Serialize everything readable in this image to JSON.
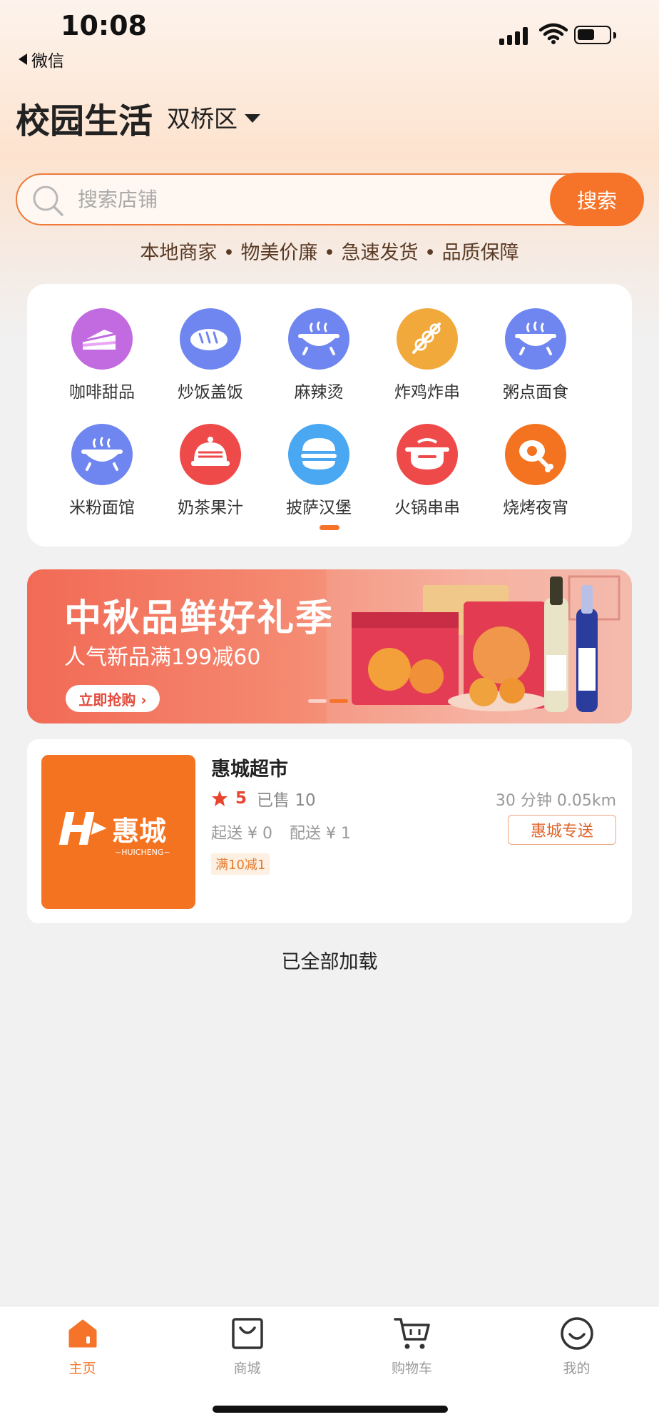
{
  "status_bar": {
    "time": "10:08",
    "back_app": "微信",
    "battery_level": 0.55
  },
  "header": {
    "title": "校园生活",
    "district": "双桥区"
  },
  "search": {
    "placeholder": "搜索店铺",
    "button_label": "搜索"
  },
  "slogan": "本地商家 • 物美价廉 • 急速发货 • 品质保障",
  "categories": [
    {
      "label": "咖啡甜品",
      "icon": "cake-icon",
      "color": "#c26ae0"
    },
    {
      "label": "炒饭盖饭",
      "icon": "bread-icon",
      "color": "#6f86f0"
    },
    {
      "label": "麻辣烫",
      "icon": "hotpot-bowl-icon",
      "color": "#6f86f0"
    },
    {
      "label": "炸鸡炸串",
      "icon": "skewer-icon",
      "color": "#f0a93a"
    },
    {
      "label": "粥点面食",
      "icon": "hotpot-bowl-icon",
      "color": "#6f86f0"
    },
    {
      "label": "米粉面馆",
      "icon": "hotpot-bowl-icon",
      "color": "#6f86f0"
    },
    {
      "label": "奶茶果汁",
      "icon": "cloche-icon",
      "color": "#ef4a4a"
    },
    {
      "label": "披萨汉堡",
      "icon": "burger-icon",
      "color": "#4aa7f2"
    },
    {
      "label": "火锅串串",
      "icon": "pot-icon",
      "color": "#ef4a4a"
    },
    {
      "label": "烧烤夜宵",
      "icon": "drumstick-icon",
      "color": "#f47321"
    }
  ],
  "banner": {
    "title": "中秋品鲜好礼季",
    "subtitle": "人气新品满199减60",
    "button_label": "立即抢购 ›"
  },
  "shop": {
    "name": "惠城超市",
    "logo_text": "惠城",
    "logo_subtext": "~HUICHENG~",
    "rating": "5",
    "sold": "已售 10",
    "distance": "30 分钟 0.05km",
    "min_order": "起送 ¥ 0",
    "delivery_fee": "配送 ¥ 1",
    "delivery_tag": "惠城专送",
    "promo": "满10减1"
  },
  "list_end_text": "已全部加载",
  "tabs": [
    {
      "label": "主页",
      "icon": "home-icon",
      "active": true
    },
    {
      "label": "商城",
      "icon": "shopping-bag-icon",
      "active": false
    },
    {
      "label": "购物车",
      "icon": "cart-icon",
      "active": false
    },
    {
      "label": "我的",
      "icon": "smile-icon",
      "active": false
    }
  ],
  "colors": {
    "accent": "#f5742a",
    "rating": "#e8452e",
    "background": "#f1f1f1"
  }
}
